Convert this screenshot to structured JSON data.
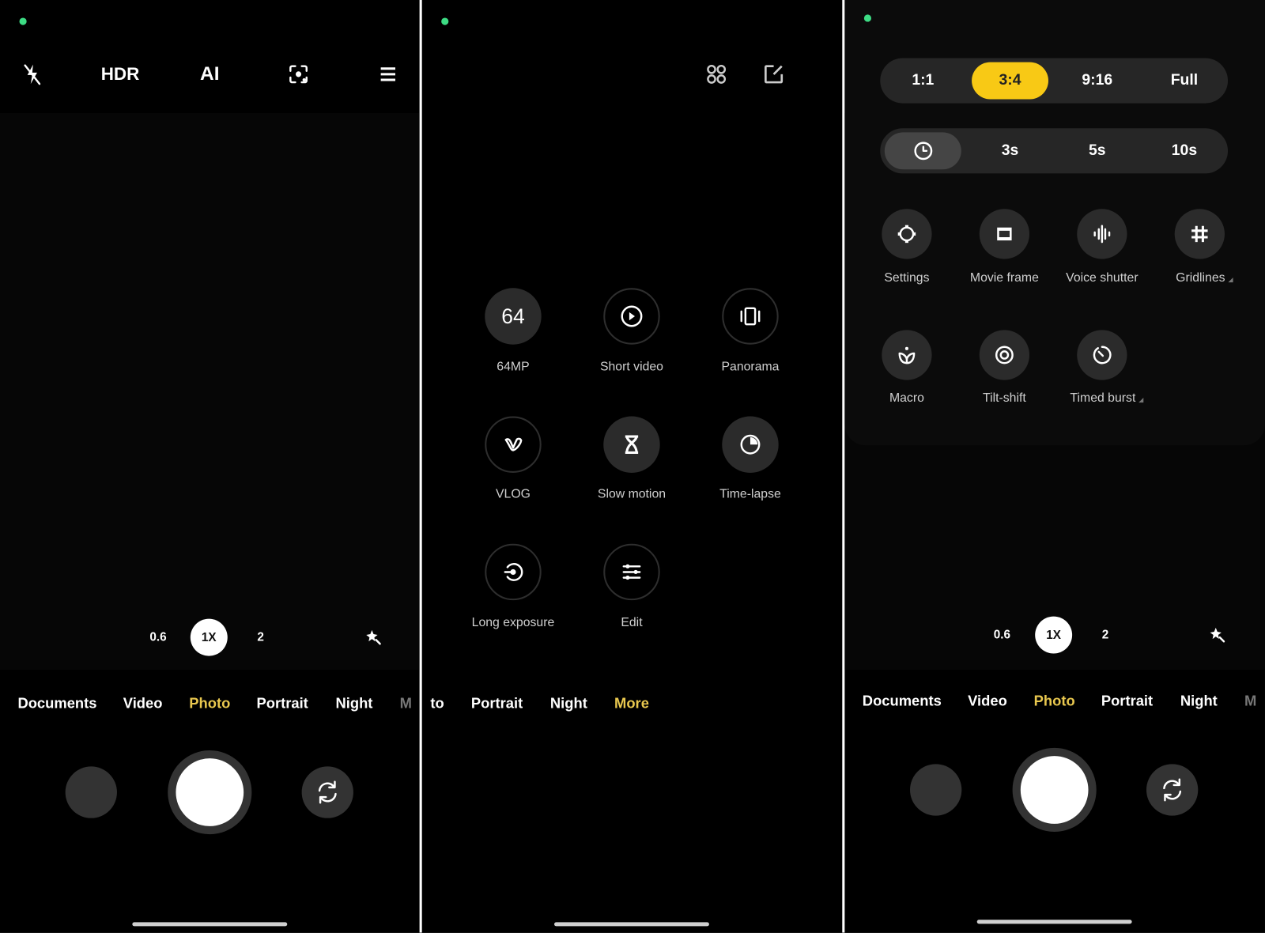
{
  "accent_colors": {
    "mode_active": "#e9c84f",
    "ratio_selected": "#f8c915",
    "privacy_dot": "#3ddc84"
  },
  "screen1": {
    "top_icons": [
      {
        "name": "flash-off-icon"
      },
      {
        "name": "hdr-off-icon",
        "label": "HDR"
      },
      {
        "name": "ai-icon",
        "label": "AI"
      },
      {
        "name": "focus-icon"
      },
      {
        "name": "menu-icon"
      }
    ],
    "zoom": {
      "options": [
        "0.6",
        "1X",
        "2"
      ],
      "selected": "1X"
    },
    "modes": [
      {
        "label": "Documents"
      },
      {
        "label": "Video"
      },
      {
        "label": "Photo",
        "active": true
      },
      {
        "label": "Portrait"
      },
      {
        "label": "Night"
      },
      {
        "label": "M",
        "dim": true
      }
    ]
  },
  "screen2": {
    "top_icons": [
      {
        "name": "grid-apps-icon"
      },
      {
        "name": "edit-icon"
      }
    ],
    "more_modes": [
      {
        "label": "64MP",
        "icon": "64",
        "filled": true
      },
      {
        "label": "Short video",
        "icon": "play-circle-icon"
      },
      {
        "label": "Panorama",
        "icon": "panorama-icon"
      },
      {
        "label": "VLOG",
        "icon": "vlog-icon"
      },
      {
        "label": "Slow motion",
        "icon": "hourglass-icon",
        "filled": true
      },
      {
        "label": "Time-lapse",
        "icon": "timelapse-icon",
        "filled": true
      },
      {
        "label": "Long exposure",
        "icon": "long-exposure-icon"
      },
      {
        "label": "Edit",
        "icon": "sliders-icon"
      }
    ],
    "modes": [
      {
        "label": "to"
      },
      {
        "label": "Portrait"
      },
      {
        "label": "Night"
      },
      {
        "label": "More",
        "active": true
      }
    ]
  },
  "screen3": {
    "aspect_ratios": {
      "options": [
        "1:1",
        "3:4",
        "9:16",
        "Full"
      ],
      "selected": "3:4"
    },
    "timer": {
      "options": [
        "timer-off-icon",
        "3s",
        "5s",
        "10s"
      ],
      "selected": "timer-off-icon"
    },
    "tools": [
      {
        "label": "Settings",
        "icon": "settings-icon"
      },
      {
        "label": "Movie frame",
        "icon": "movie-frame-icon"
      },
      {
        "label": "Voice shutter",
        "icon": "voice-shutter-icon"
      },
      {
        "label": "Gridlines",
        "icon": "gridlines-icon",
        "submenu": true
      },
      {
        "label": "Macro",
        "icon": "macro-icon"
      },
      {
        "label": "Tilt-shift",
        "icon": "tilt-shift-icon"
      },
      {
        "label": "Timed burst",
        "icon": "timed-burst-icon",
        "submenu": true
      }
    ],
    "zoom": {
      "options": [
        "0.6",
        "1X",
        "2"
      ],
      "selected": "1X"
    },
    "modes": [
      {
        "label": "Documents"
      },
      {
        "label": "Video"
      },
      {
        "label": "Photo",
        "active": true
      },
      {
        "label": "Portrait"
      },
      {
        "label": "Night"
      },
      {
        "label": "M",
        "dim": true
      }
    ]
  }
}
